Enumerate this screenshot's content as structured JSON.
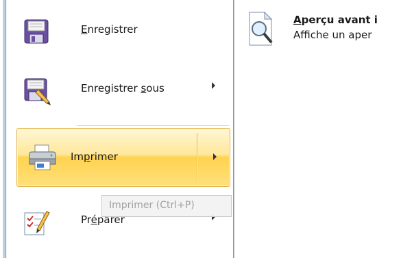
{
  "menu": {
    "items": [
      {
        "id": "save",
        "label_pre": "",
        "label_key": "E",
        "label_post": "nregistrer",
        "has_submenu": false,
        "icon": "floppy-disk-icon"
      },
      {
        "id": "save_as",
        "label_pre": "Enregistrer ",
        "label_key": "s",
        "label_post": "ous",
        "has_submenu": true,
        "icon": "floppy-disk-pencil-icon"
      },
      {
        "id": "print",
        "label_pre": "Im",
        "label_key": "p",
        "label_post": "rimer",
        "has_submenu": true,
        "icon": "printer-icon",
        "selected": true
      },
      {
        "id": "prepare",
        "label_pre": "Pr",
        "label_key": "é",
        "label_post": "parer",
        "has_submenu": true,
        "icon": "pencil-checklist-icon"
      }
    ]
  },
  "tooltip": {
    "text": "Imprimer (Ctrl+P)"
  },
  "submenu": {
    "items": [
      {
        "title_key": "A",
        "title_rest": "perçu avant i",
        "description": "Affiche un aper",
        "icon": "magnifier-page-icon"
      }
    ]
  },
  "colors": {
    "selection_top": "#fff7d6",
    "selection_mid": "#ffd34f",
    "selection_border": "#e2b44c",
    "frame_border": "#8797ad"
  }
}
